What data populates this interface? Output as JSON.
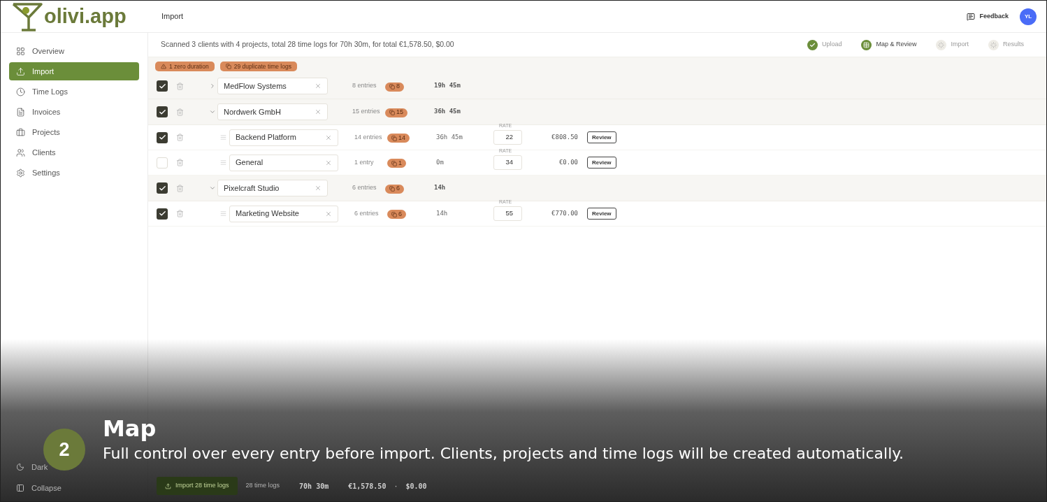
{
  "logo": {
    "text": "olivi.app"
  },
  "header": {
    "title": "Import",
    "feedback": "Feedback",
    "avatar": "YL"
  },
  "sidebar": {
    "items": [
      {
        "label": "Overview",
        "selected": false
      },
      {
        "label": "Import",
        "selected": true
      },
      {
        "label": "Time Logs",
        "selected": false
      },
      {
        "label": "Invoices",
        "selected": false
      },
      {
        "label": "Projects",
        "selected": false
      },
      {
        "label": "Clients",
        "selected": false
      },
      {
        "label": "Settings",
        "selected": false
      }
    ],
    "footer": [
      {
        "label": "Dark"
      },
      {
        "label": "Collapse"
      }
    ]
  },
  "summary": "Scanned 3 clients with 4 projects, total 28 time logs for 70h 30m, for total €1,578.50, $0.00",
  "steps": [
    {
      "label": "Upload",
      "done": true,
      "selected": false
    },
    {
      "label": "Map & Review",
      "done": false,
      "selected": true
    },
    {
      "label": "Import",
      "done": false,
      "selected": false
    },
    {
      "label": "Results",
      "done": false,
      "selected": false
    }
  ],
  "warnings": [
    {
      "kind": "warning",
      "text": "1 zero duration"
    },
    {
      "kind": "duplicate",
      "text": "29 duplicate time logs"
    }
  ],
  "clients": [
    {
      "name": "MedFlow Systems",
      "checked": true,
      "expanded": false,
      "entries": "8 entries",
      "duplicates": "8",
      "duration": "19h 45m"
    },
    {
      "name": "Nordwerk GmbH",
      "checked": true,
      "expanded": true,
      "entries": "15 entries",
      "duplicates": "15",
      "duration": "36h 45m",
      "projects": [
        {
          "name": "Backend Platform",
          "checked": true,
          "entries": "14 entries",
          "duplicates": "14",
          "duration": "36h 45m",
          "rate_label": "RATE",
          "rate": "22",
          "amount": "€808.50",
          "action": "Review"
        },
        {
          "name": "General",
          "checked": false,
          "entries": "1 entry",
          "duplicates": "1",
          "duration": "0m",
          "rate_label": "RATE",
          "rate": "34",
          "amount": "€0.00",
          "action": "Review"
        }
      ]
    },
    {
      "name": "Pixelcraft Studio",
      "checked": true,
      "expanded": true,
      "entries": "6 entries",
      "duplicates": "6",
      "duration": "14h",
      "projects": [
        {
          "name": "Marketing Website",
          "checked": true,
          "entries": "6 entries",
          "duplicates": "6",
          "duration": "14h",
          "rate_label": "RATE",
          "rate": "55",
          "amount": "€770.00",
          "action": "Review"
        }
      ]
    }
  ],
  "footer_bar": {
    "button": "Import 28 time logs",
    "count": "28 time logs",
    "duration": "70h 30m",
    "total_eur": "€1,578.50",
    "separator": "·",
    "total_usd": "$0.00"
  },
  "caption": {
    "step": "2",
    "title": "Map",
    "text": "Full control over every entry before import. Clients, projects and time logs will be created automatically."
  }
}
